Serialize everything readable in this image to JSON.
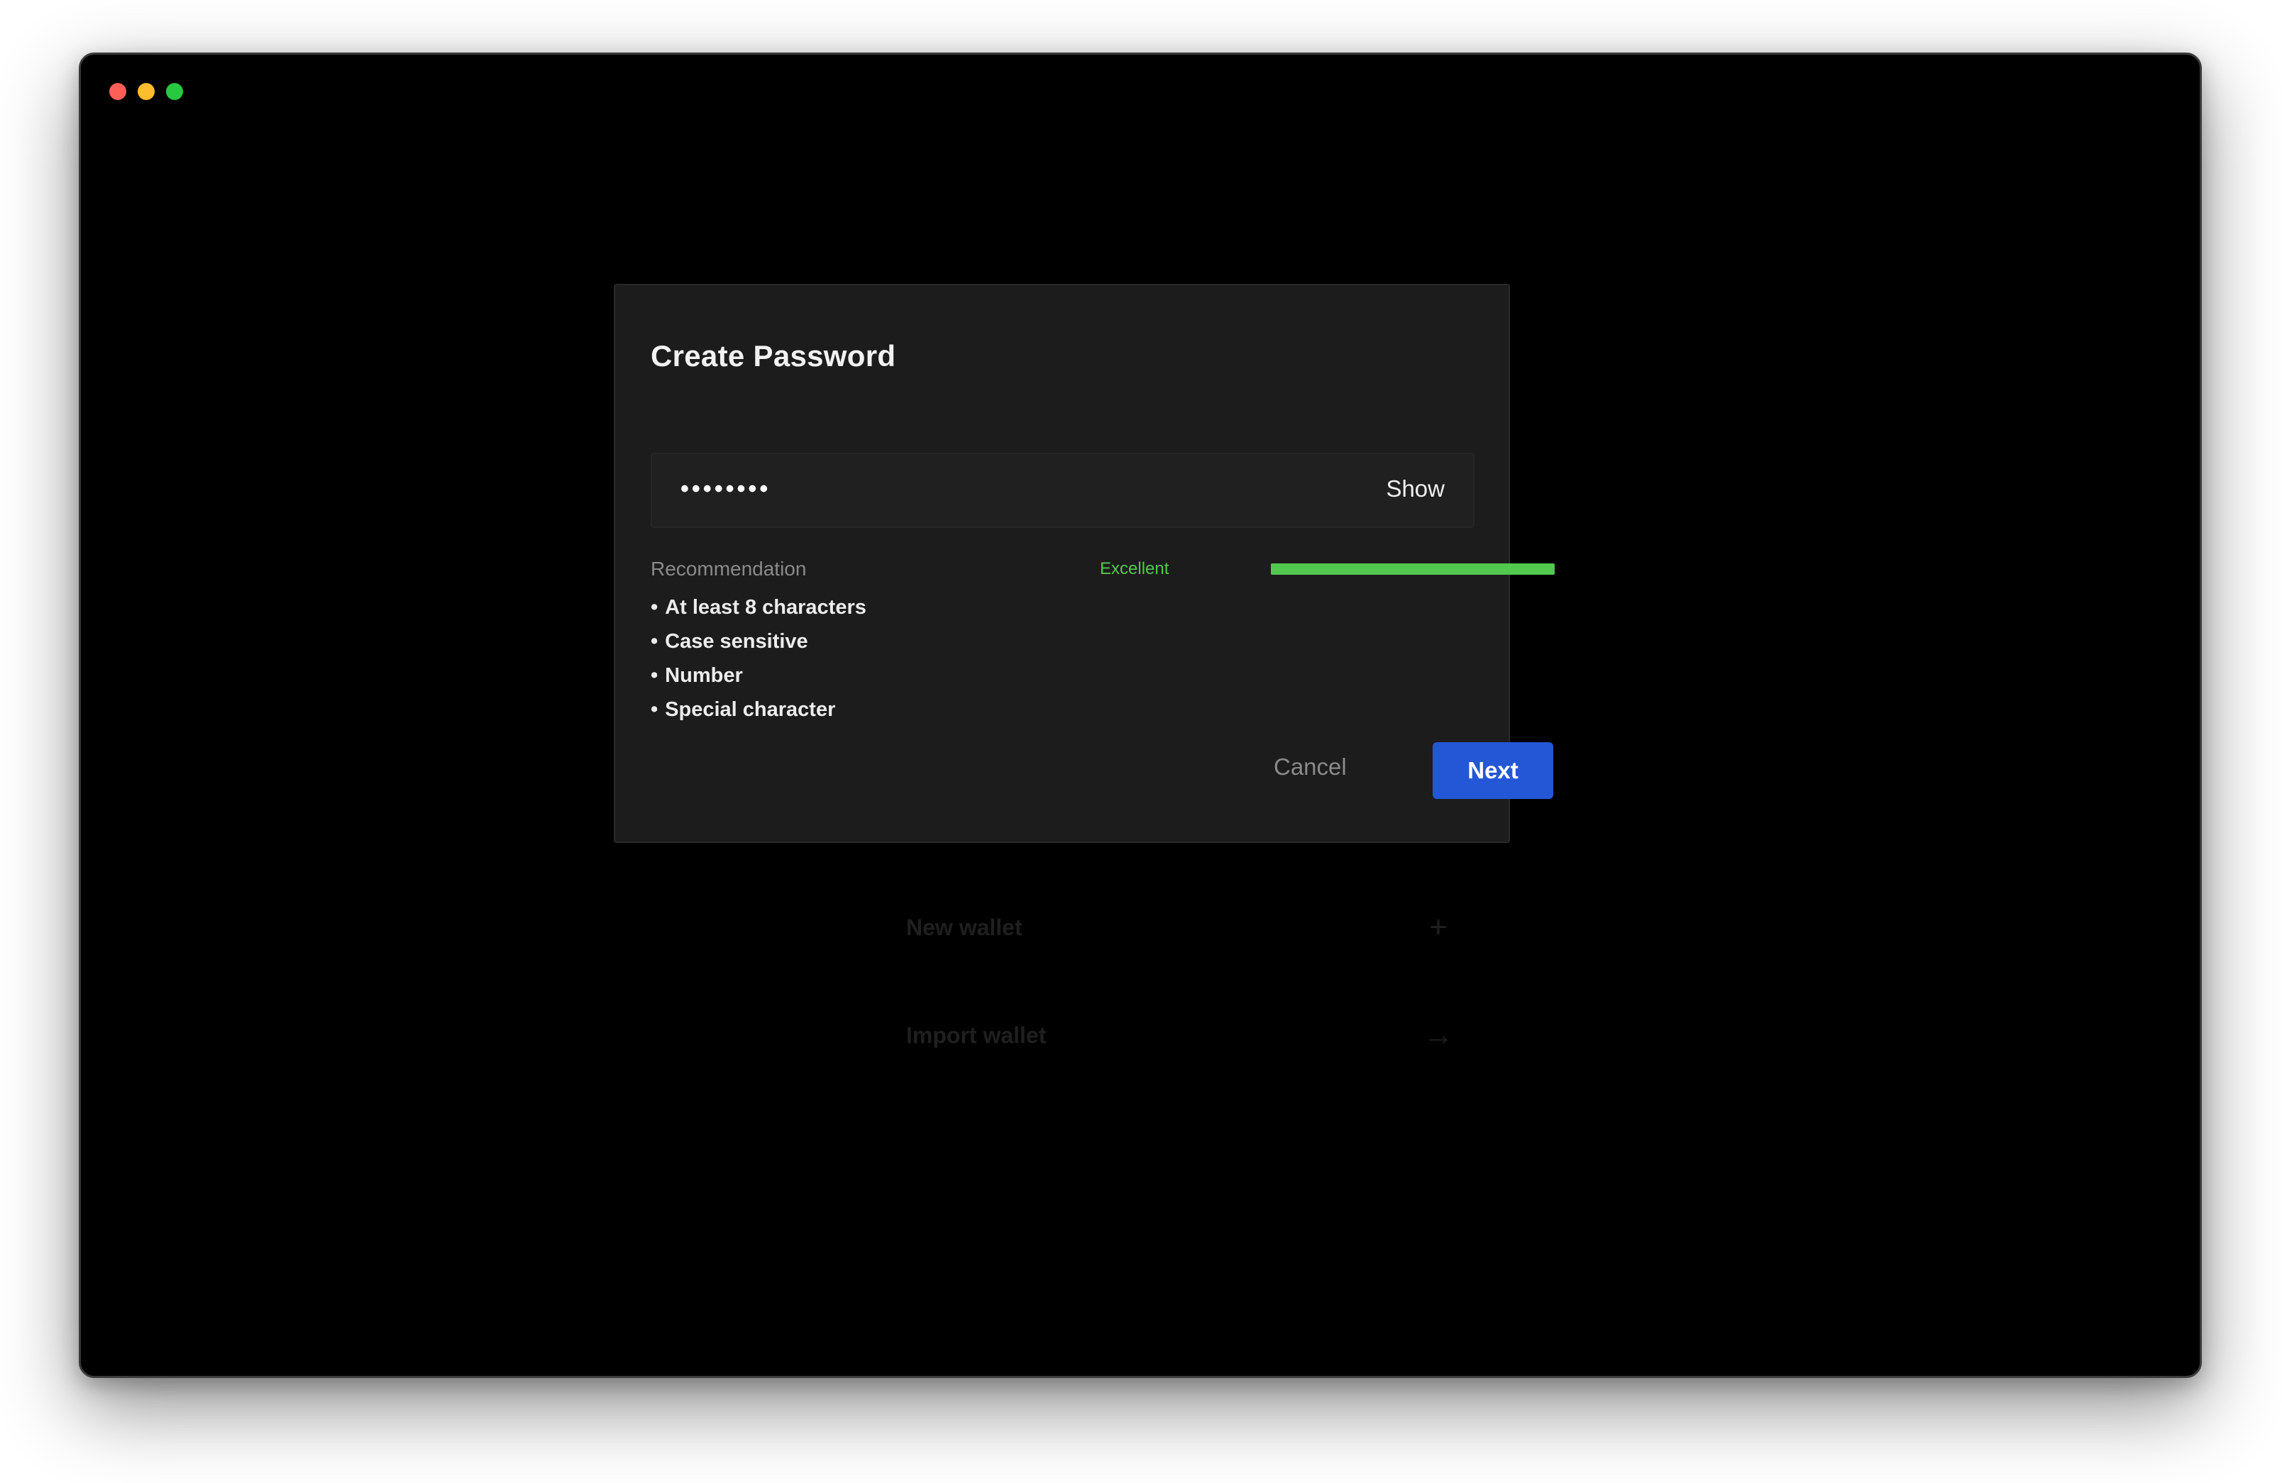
{
  "window": {
    "controls": [
      "close",
      "minimize",
      "maximize"
    ]
  },
  "background": {
    "options": [
      {
        "label": "New wallet",
        "icon": "plus-icon",
        "glyph": "+"
      },
      {
        "label": "Import wallet",
        "icon": "arrow-right-icon",
        "glyph": "→"
      }
    ]
  },
  "modal": {
    "title": "Create Password",
    "password": {
      "masked_value": "••••••••",
      "toggle_label": "Show"
    },
    "recommendation": {
      "title": "Recommendation",
      "items": [
        "At least 8 characters",
        "Case sensitive",
        "Number",
        "Special character"
      ]
    },
    "strength": {
      "label": "Excellent",
      "level": 1.0,
      "color": "#52c84f"
    },
    "actions": {
      "cancel_label": "Cancel",
      "next_label": "Next",
      "next_color": "#2457d6"
    }
  }
}
